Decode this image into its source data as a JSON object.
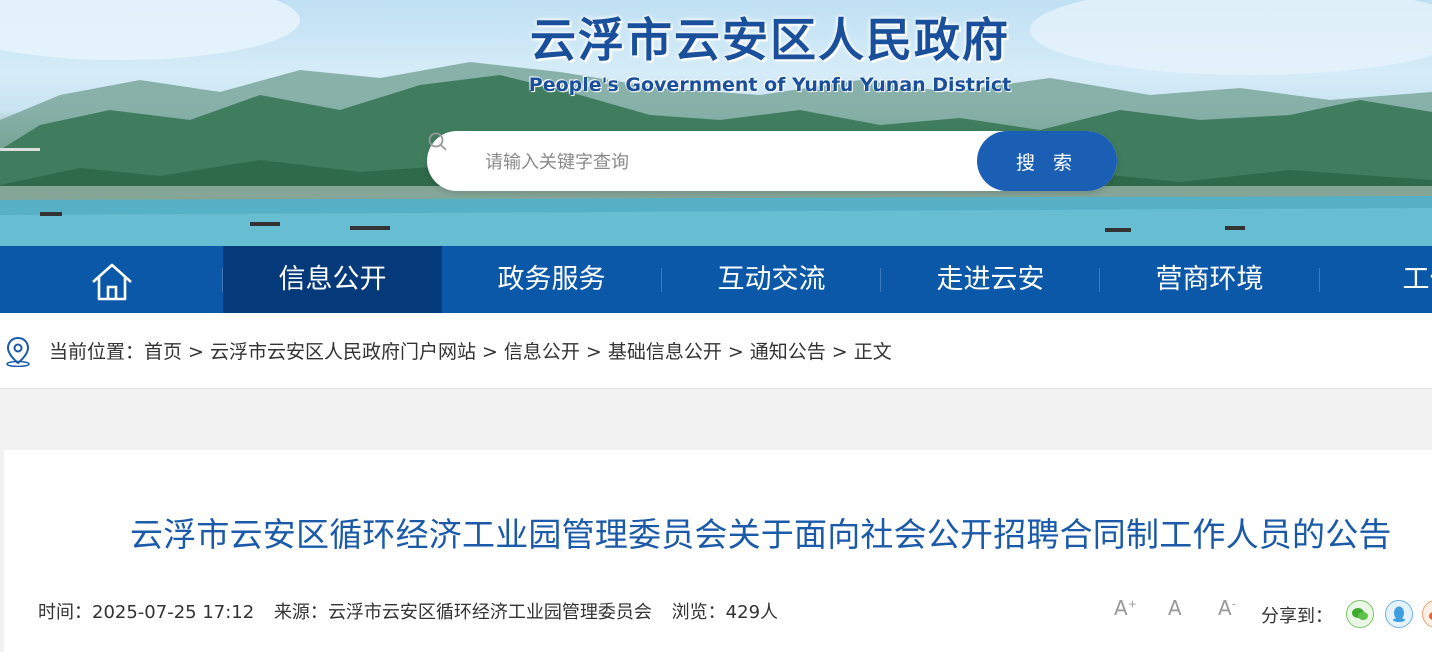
{
  "header": {
    "title": "云浮市云安区人民政府",
    "subtitle": "People's Government of Yunfu Yunan District"
  },
  "search": {
    "placeholder": "请输入关键字查询",
    "button_label": "搜 索"
  },
  "nav": {
    "items": [
      {
        "label": "信息公开"
      },
      {
        "label": "政务服务"
      },
      {
        "label": "互动交流"
      },
      {
        "label": "走进云安"
      },
      {
        "label": "营商环境"
      },
      {
        "label": "工作"
      }
    ]
  },
  "breadcrumb": {
    "prefix": "当前位置：",
    "items": [
      "首页",
      "云浮市云安区人民政府门户网站",
      "信息公开",
      "基础信息公开",
      "通知公告",
      "正文"
    ],
    "separator": ">"
  },
  "article": {
    "title": "云浮市云安区循环经济工业园管理委员会关于面向社会公开招聘合同制工作人员的公告",
    "time_label": "时间：",
    "time": "2025-07-25 17:12",
    "source_label": "来源：",
    "source": "云浮市云安区循环经济工业园管理委员会",
    "views_label": "浏览：",
    "views": "429人",
    "font_tools": [
      "A",
      "A",
      "A"
    ],
    "share_label": "分享到："
  },
  "colors": {
    "nav_bg": "#0c58a8",
    "nav_active": "#053a7a",
    "title_blue": "#1a5aa8",
    "search_button": "#1a5fb4"
  },
  "icons": [
    "search-icon",
    "home-icon",
    "location-pin-icon",
    "font-increase-icon",
    "font-default-icon",
    "font-decrease-icon",
    "wechat-icon",
    "qq-icon",
    "weibo-icon"
  ]
}
